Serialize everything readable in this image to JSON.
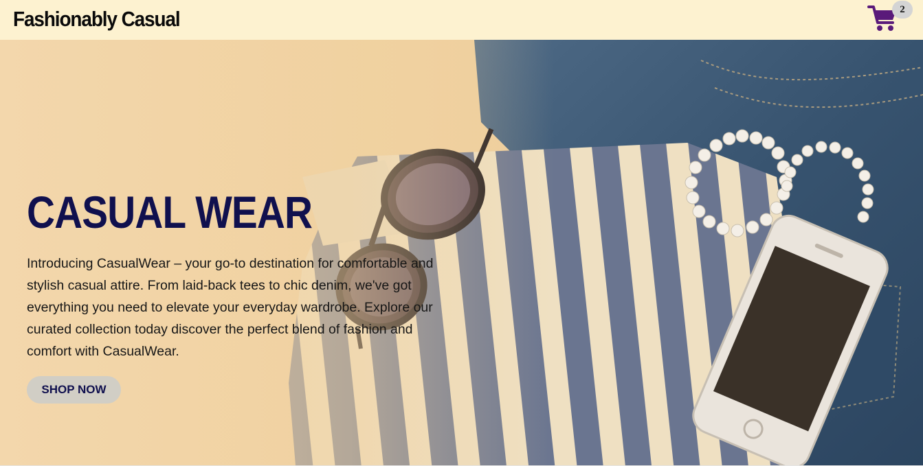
{
  "header": {
    "brand": "Fashionably Casual",
    "cart_icon": "shopping-cart-icon",
    "cart_count": "2",
    "background_color": "#fdf2d0"
  },
  "hero": {
    "title": "CASUAL WEAR",
    "description": "Introducing CasualWear – your go-to destination for comfortable and stylish casual attire. From laid-back tees to chic denim, we've got everything you need to elevate your everyday wardrobe. Explore our curated collection today discover the perfect blend of fashion and comfort with CasualWear.",
    "cta_label": "SHOP NOW",
    "title_color": "#10104e",
    "accent_color": "#5a1a7a"
  }
}
